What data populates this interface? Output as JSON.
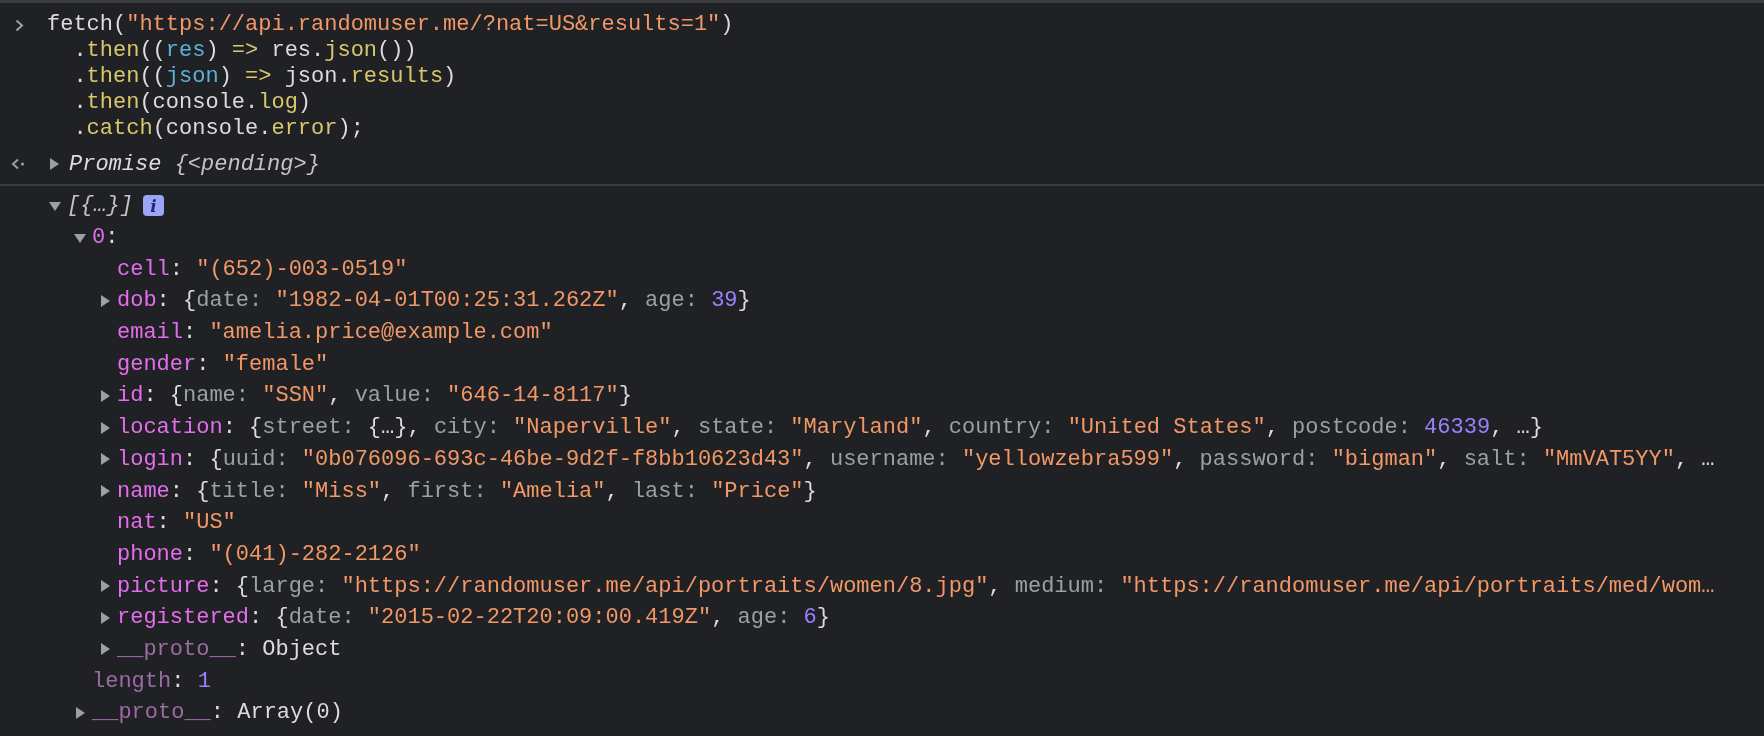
{
  "input": {
    "lines": [
      [
        {
          "text": "fetch(",
          "kind": "plain"
        },
        {
          "text": "\"https://api.randomuser.me/?nat=US&results=1\"",
          "kind": "string"
        },
        {
          "text": ")",
          "kind": "plain"
        }
      ],
      [
        {
          "text": "  .",
          "kind": "plain"
        },
        {
          "text": "then",
          "kind": "method"
        },
        {
          "text": "((",
          "kind": "plain"
        },
        {
          "text": "res",
          "kind": "param"
        },
        {
          "text": ") ",
          "kind": "plain"
        },
        {
          "text": "=>",
          "kind": "method"
        },
        {
          "text": " res.",
          "kind": "plain"
        },
        {
          "text": "json",
          "kind": "method"
        },
        {
          "text": "())",
          "kind": "plain"
        }
      ],
      [
        {
          "text": "  .",
          "kind": "plain"
        },
        {
          "text": "then",
          "kind": "method"
        },
        {
          "text": "((",
          "kind": "plain"
        },
        {
          "text": "json",
          "kind": "param"
        },
        {
          "text": ") ",
          "kind": "plain"
        },
        {
          "text": "=>",
          "kind": "method"
        },
        {
          "text": " json.",
          "kind": "plain"
        },
        {
          "text": "results",
          "kind": "method"
        },
        {
          "text": ")",
          "kind": "plain"
        }
      ],
      [
        {
          "text": "  .",
          "kind": "plain"
        },
        {
          "text": "then",
          "kind": "method"
        },
        {
          "text": "(console.",
          "kind": "plain"
        },
        {
          "text": "log",
          "kind": "method"
        },
        {
          "text": ")",
          "kind": "plain"
        }
      ],
      [
        {
          "text": "  .",
          "kind": "plain"
        },
        {
          "text": "catch",
          "kind": "method"
        },
        {
          "text": "(console.",
          "kind": "plain"
        },
        {
          "text": "error",
          "kind": "method"
        },
        {
          "text": ");",
          "kind": "plain"
        }
      ]
    ]
  },
  "result": {
    "expanded": false,
    "tokens": [
      {
        "text": "Promise ",
        "kind": "italic"
      },
      {
        "text": "{<pending>}",
        "kind": "dim-italic"
      }
    ]
  },
  "log": {
    "tree": [
      {
        "kind": "node",
        "expanded": true,
        "badge": "i",
        "tokens": [
          {
            "text": "[{…}]",
            "kind": "dim-italic"
          }
        ],
        "children": [
          {
            "kind": "node",
            "expanded": true,
            "tokens": [
              {
                "text": "0",
                "kind": "key"
              },
              {
                "text": ":",
                "kind": "plain"
              }
            ],
            "children": [
              {
                "kind": "leaf",
                "tokens": [
                  {
                    "text": "cell",
                    "kind": "key"
                  },
                  {
                    "text": ": ",
                    "kind": "plain"
                  },
                  {
                    "text": "\"(652)-003-0519\"",
                    "kind": "string"
                  }
                ]
              },
              {
                "kind": "node",
                "expanded": false,
                "tokens": [
                  {
                    "text": "dob",
                    "kind": "key"
                  },
                  {
                    "text": ": {",
                    "kind": "plain"
                  },
                  {
                    "text": "date: ",
                    "kind": "subkey"
                  },
                  {
                    "text": "\"1982-04-01T00:25:31.262Z\"",
                    "kind": "string"
                  },
                  {
                    "text": ", ",
                    "kind": "plain"
                  },
                  {
                    "text": "age: ",
                    "kind": "subkey"
                  },
                  {
                    "text": "39",
                    "kind": "number"
                  },
                  {
                    "text": "}",
                    "kind": "plain"
                  }
                ]
              },
              {
                "kind": "leaf",
                "tokens": [
                  {
                    "text": "email",
                    "kind": "key"
                  },
                  {
                    "text": ": ",
                    "kind": "plain"
                  },
                  {
                    "text": "\"amelia.price@example.com\"",
                    "kind": "string"
                  }
                ]
              },
              {
                "kind": "leaf",
                "tokens": [
                  {
                    "text": "gender",
                    "kind": "key"
                  },
                  {
                    "text": ": ",
                    "kind": "plain"
                  },
                  {
                    "text": "\"female\"",
                    "kind": "string"
                  }
                ]
              },
              {
                "kind": "node",
                "expanded": false,
                "tokens": [
                  {
                    "text": "id",
                    "kind": "key"
                  },
                  {
                    "text": ": {",
                    "kind": "plain"
                  },
                  {
                    "text": "name: ",
                    "kind": "subkey"
                  },
                  {
                    "text": "\"SSN\"",
                    "kind": "string"
                  },
                  {
                    "text": ", ",
                    "kind": "plain"
                  },
                  {
                    "text": "value: ",
                    "kind": "subkey"
                  },
                  {
                    "text": "\"646-14-8117\"",
                    "kind": "string"
                  },
                  {
                    "text": "}",
                    "kind": "plain"
                  }
                ]
              },
              {
                "kind": "node",
                "expanded": false,
                "tokens": [
                  {
                    "text": "location",
                    "kind": "key"
                  },
                  {
                    "text": ": {",
                    "kind": "plain"
                  },
                  {
                    "text": "street: ",
                    "kind": "subkey"
                  },
                  {
                    "text": "{…}",
                    "kind": "plain"
                  },
                  {
                    "text": ", ",
                    "kind": "plain"
                  },
                  {
                    "text": "city: ",
                    "kind": "subkey"
                  },
                  {
                    "text": "\"Naperville\"",
                    "kind": "string"
                  },
                  {
                    "text": ", ",
                    "kind": "plain"
                  },
                  {
                    "text": "state: ",
                    "kind": "subkey"
                  },
                  {
                    "text": "\"Maryland\"",
                    "kind": "string"
                  },
                  {
                    "text": ", ",
                    "kind": "plain"
                  },
                  {
                    "text": "country: ",
                    "kind": "subkey"
                  },
                  {
                    "text": "\"United States\"",
                    "kind": "string"
                  },
                  {
                    "text": ", ",
                    "kind": "plain"
                  },
                  {
                    "text": "postcode: ",
                    "kind": "subkey"
                  },
                  {
                    "text": "46339",
                    "kind": "number"
                  },
                  {
                    "text": ", …}",
                    "kind": "plain"
                  }
                ]
              },
              {
                "kind": "node",
                "expanded": false,
                "tokens": [
                  {
                    "text": "login",
                    "kind": "key"
                  },
                  {
                    "text": ": {",
                    "kind": "plain"
                  },
                  {
                    "text": "uuid: ",
                    "kind": "subkey"
                  },
                  {
                    "text": "\"0b076096-693c-46be-9d2f-f8bb10623d43\"",
                    "kind": "string"
                  },
                  {
                    "text": ", ",
                    "kind": "plain"
                  },
                  {
                    "text": "username: ",
                    "kind": "subkey"
                  },
                  {
                    "text": "\"yellowzebra599\"",
                    "kind": "string"
                  },
                  {
                    "text": ", ",
                    "kind": "plain"
                  },
                  {
                    "text": "password: ",
                    "kind": "subkey"
                  },
                  {
                    "text": "\"bigman\"",
                    "kind": "string"
                  },
                  {
                    "text": ", ",
                    "kind": "plain"
                  },
                  {
                    "text": "salt: ",
                    "kind": "subkey"
                  },
                  {
                    "text": "\"MmVAT5YY\"",
                    "kind": "string"
                  },
                  {
                    "text": ", …",
                    "kind": "plain"
                  }
                ]
              },
              {
                "kind": "node",
                "expanded": false,
                "tokens": [
                  {
                    "text": "name",
                    "kind": "key"
                  },
                  {
                    "text": ": {",
                    "kind": "plain"
                  },
                  {
                    "text": "title: ",
                    "kind": "subkey"
                  },
                  {
                    "text": "\"Miss\"",
                    "kind": "string"
                  },
                  {
                    "text": ", ",
                    "kind": "plain"
                  },
                  {
                    "text": "first: ",
                    "kind": "subkey"
                  },
                  {
                    "text": "\"Amelia\"",
                    "kind": "string"
                  },
                  {
                    "text": ", ",
                    "kind": "plain"
                  },
                  {
                    "text": "last: ",
                    "kind": "subkey"
                  },
                  {
                    "text": "\"Price\"",
                    "kind": "string"
                  },
                  {
                    "text": "}",
                    "kind": "plain"
                  }
                ]
              },
              {
                "kind": "leaf",
                "tokens": [
                  {
                    "text": "nat",
                    "kind": "key"
                  },
                  {
                    "text": ": ",
                    "kind": "plain"
                  },
                  {
                    "text": "\"US\"",
                    "kind": "string"
                  }
                ]
              },
              {
                "kind": "leaf",
                "tokens": [
                  {
                    "text": "phone",
                    "kind": "key"
                  },
                  {
                    "text": ": ",
                    "kind": "plain"
                  },
                  {
                    "text": "\"(041)-282-2126\"",
                    "kind": "string"
                  }
                ]
              },
              {
                "kind": "node",
                "expanded": false,
                "tokens": [
                  {
                    "text": "picture",
                    "kind": "key"
                  },
                  {
                    "text": ": {",
                    "kind": "plain"
                  },
                  {
                    "text": "large: ",
                    "kind": "subkey"
                  },
                  {
                    "text": "\"https://randomuser.me/api/portraits/women/8.jpg\"",
                    "kind": "string"
                  },
                  {
                    "text": ", ",
                    "kind": "plain"
                  },
                  {
                    "text": "medium: ",
                    "kind": "subkey"
                  },
                  {
                    "text": "\"https://randomuser.me/api/portraits/med/wom…",
                    "kind": "string"
                  }
                ]
              },
              {
                "kind": "node",
                "expanded": false,
                "tokens": [
                  {
                    "text": "registered",
                    "kind": "key"
                  },
                  {
                    "text": ": {",
                    "kind": "plain"
                  },
                  {
                    "text": "date: ",
                    "kind": "subkey"
                  },
                  {
                    "text": "\"2015-02-22T20:09:00.419Z\"",
                    "kind": "string"
                  },
                  {
                    "text": ", ",
                    "kind": "plain"
                  },
                  {
                    "text": "age: ",
                    "kind": "subkey"
                  },
                  {
                    "text": "6",
                    "kind": "number"
                  },
                  {
                    "text": "}",
                    "kind": "plain"
                  }
                ]
              },
              {
                "kind": "node",
                "expanded": false,
                "tokens": [
                  {
                    "text": "__proto__",
                    "kind": "hidden-key"
                  },
                  {
                    "text": ": Object",
                    "kind": "plain"
                  }
                ]
              }
            ]
          },
          {
            "kind": "leaf",
            "tokens": [
              {
                "text": "length",
                "kind": "hidden-key"
              },
              {
                "text": ": ",
                "kind": "plain"
              },
              {
                "text": "1",
                "kind": "number"
              }
            ]
          },
          {
            "kind": "node",
            "expanded": false,
            "tokens": [
              {
                "text": "__proto__",
                "kind": "hidden-key"
              },
              {
                "text": ": Array(0)",
                "kind": "plain"
              }
            ]
          }
        ]
      }
    ]
  }
}
